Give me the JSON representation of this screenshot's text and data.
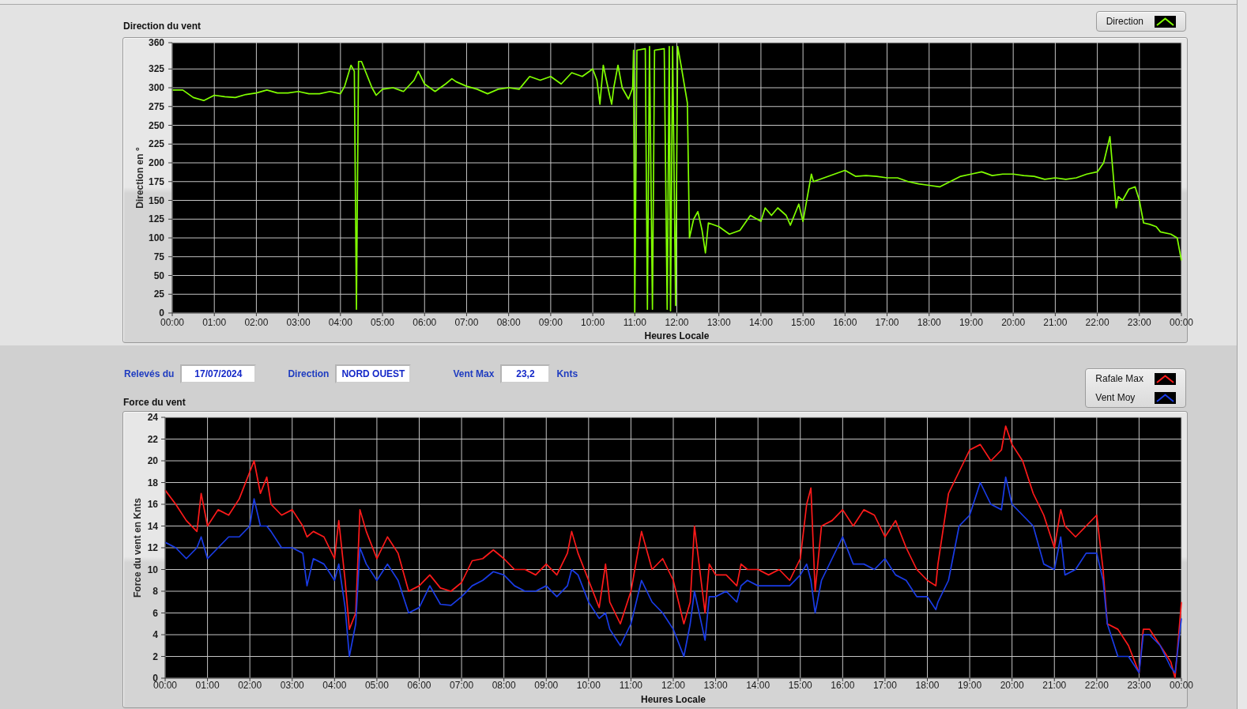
{
  "direction_chart": {
    "chart_data": {
      "type": "line",
      "title": "Direction du vent",
      "xlabel": "Heures Locale",
      "ylabel": "Direction en °",
      "grid": true,
      "legend": true,
      "x": [
        0,
        0.25,
        0.5,
        0.75,
        1,
        1.25,
        1.5,
        1.75,
        2,
        2.25,
        2.5,
        2.75,
        3,
        3.25,
        3.5,
        3.75,
        4,
        4.1,
        4.25,
        4.33,
        4.38,
        4.43,
        4.5,
        4.75,
        4.85,
        5,
        5.25,
        5.5,
        5.75,
        5.85,
        6,
        6.25,
        6.5,
        6.65,
        6.75,
        7,
        7.25,
        7.5,
        7.75,
        8,
        8.25,
        8.5,
        8.75,
        9,
        9.25,
        9.5,
        9.75,
        10,
        10.1,
        10.17,
        10.25,
        10.4,
        10.45,
        10.5,
        10.6,
        10.7,
        10.85,
        10.95,
        10.97,
        11,
        11.05,
        11.25,
        11.3,
        11.35,
        11.42,
        11.47,
        11.7,
        11.77,
        11.82,
        11.85,
        11.9,
        11.97,
        12.02,
        12.1,
        12.25,
        12.3,
        12.4,
        12.5,
        12.6,
        12.68,
        12.75,
        13,
        13.25,
        13.5,
        13.75,
        14,
        14.1,
        14.25,
        14.4,
        14.6,
        14.7,
        14.9,
        15,
        15.2,
        15.25,
        15.5,
        15.75,
        16,
        16.25,
        16.5,
        16.75,
        17,
        17.25,
        17.5,
        17.75,
        18,
        18.25,
        18.5,
        18.75,
        19,
        19.25,
        19.5,
        19.75,
        20,
        20.25,
        20.5,
        20.75,
        21,
        21.25,
        21.5,
        21.75,
        22,
        22.15,
        22.3,
        22.4,
        22.45,
        22.5,
        22.6,
        22.75,
        22.9,
        23,
        23.1,
        23.25,
        23.4,
        23.5,
        23.75,
        23.9,
        24
      ],
      "series": [
        {
          "name": "Direction",
          "color": "#80ff00",
          "values": [
            297,
            297,
            287,
            283,
            290,
            288,
            287,
            291,
            293,
            297,
            293,
            293,
            295,
            292,
            292,
            295,
            292,
            302,
            330,
            322,
            5,
            335,
            335,
            300,
            290,
            298,
            300,
            295,
            310,
            322,
            305,
            295,
            305,
            312,
            308,
            302,
            298,
            292,
            298,
            300,
            298,
            315,
            310,
            315,
            305,
            320,
            315,
            325,
            310,
            278,
            330,
            290,
            278,
            300,
            330,
            300,
            285,
            300,
            350,
            0,
            350,
            352,
            5,
            355,
            5,
            350,
            352,
            5,
            355,
            3,
            355,
            10,
            355,
            330,
            280,
            100,
            125,
            135,
            110,
            80,
            120,
            115,
            105,
            110,
            130,
            122,
            140,
            130,
            140,
            130,
            117,
            145,
            122,
            185,
            175,
            180,
            185,
            190,
            182,
            183,
            182,
            180,
            180,
            175,
            172,
            170,
            168,
            175,
            182,
            185,
            188,
            183,
            185,
            185,
            183,
            182,
            178,
            180,
            178,
            180,
            185,
            188,
            200,
            235,
            170,
            140,
            155,
            150,
            165,
            168,
            150,
            120,
            118,
            115,
            108,
            105,
            100,
            70
          ]
        }
      ],
      "xlim": [
        0,
        24
      ],
      "ylim": [
        0,
        360
      ],
      "xticks": [
        {
          "value": 0,
          "label": "00:00"
        },
        {
          "value": 1,
          "label": "01:00"
        },
        {
          "value": 2,
          "label": "02:00"
        },
        {
          "value": 3,
          "label": "03:00"
        },
        {
          "value": 4,
          "label": "04:00"
        },
        {
          "value": 5,
          "label": "05:00"
        },
        {
          "value": 6,
          "label": "06:00"
        },
        {
          "value": 7,
          "label": "07:00"
        },
        {
          "value": 8,
          "label": "08:00"
        },
        {
          "value": 9,
          "label": "09:00"
        },
        {
          "value": 10,
          "label": "10:00"
        },
        {
          "value": 11,
          "label": "11:00"
        },
        {
          "value": 12,
          "label": "12:00"
        },
        {
          "value": 13,
          "label": "13:00"
        },
        {
          "value": 14,
          "label": "14:00"
        },
        {
          "value": 15,
          "label": "15:00"
        },
        {
          "value": 16,
          "label": "16:00"
        },
        {
          "value": 17,
          "label": "17:00"
        },
        {
          "value": 18,
          "label": "18:00"
        },
        {
          "value": 19,
          "label": "19:00"
        },
        {
          "value": 20,
          "label": "20:00"
        },
        {
          "value": 21,
          "label": "21:00"
        },
        {
          "value": 22,
          "label": "22:00"
        },
        {
          "value": 23,
          "label": "23:00"
        },
        {
          "value": 24,
          "label": "00:00"
        }
      ],
      "yticks": [
        0,
        25,
        50,
        75,
        100,
        125,
        150,
        175,
        200,
        225,
        250,
        275,
        300,
        325,
        360
      ]
    }
  },
  "readings": [
    {
      "label": "Relevés du",
      "value": "17/07/2024"
    },
    {
      "label": "Direction",
      "value": "NORD OUEST"
    },
    {
      "label": "Vent Max",
      "value": "23,2",
      "unit": "Knts"
    }
  ],
  "force_chart": {
    "chart_data": {
      "type": "line",
      "title": "Force du vent",
      "xlabel": "Heures Locale",
      "ylabel": "Force du vent en Knts",
      "grid": true,
      "legend": true,
      "x": [
        0,
        0.25,
        0.5,
        0.75,
        0.85,
        1,
        1.25,
        1.5,
        1.75,
        2,
        2.1,
        2.25,
        2.4,
        2.5,
        2.75,
        3,
        3.25,
        3.35,
        3.5,
        3.75,
        4,
        4.1,
        4.25,
        4.35,
        4.5,
        4.6,
        4.75,
        5,
        5.25,
        5.5,
        5.75,
        6,
        6.25,
        6.5,
        6.75,
        7,
        7.25,
        7.5,
        7.75,
        8,
        8.25,
        8.5,
        8.75,
        9,
        9.25,
        9.5,
        9.6,
        9.75,
        10,
        10.25,
        10.4,
        10.5,
        10.75,
        11,
        11.25,
        11.5,
        11.75,
        12,
        12.25,
        12.4,
        12.5,
        12.75,
        12.85,
        13,
        13.25,
        13.5,
        13.6,
        13.75,
        14,
        14.25,
        14.5,
        14.75,
        15,
        15.15,
        15.25,
        15.35,
        15.5,
        15.75,
        16,
        16.25,
        16.5,
        16.75,
        17,
        17.25,
        17.5,
        17.75,
        18,
        18.2,
        18.25,
        18.5,
        18.75,
        19,
        19.25,
        19.5,
        19.75,
        19.85,
        20,
        20.25,
        20.5,
        20.75,
        21,
        21.15,
        21.25,
        21.5,
        21.75,
        22,
        22.15,
        22.25,
        22.5,
        22.75,
        23,
        23.1,
        23.25,
        23.5,
        23.75,
        23.85,
        24
      ],
      "series": [
        {
          "name": "Rafale Max",
          "color": "#ff1a1a",
          "values": [
            17.3,
            16,
            14.5,
            13.5,
            17,
            14,
            15.5,
            15,
            16.5,
            19,
            20,
            17,
            18.5,
            16,
            15,
            15.5,
            14,
            13,
            13.5,
            13,
            11,
            14.5,
            9,
            4.5,
            6,
            15.5,
            13.5,
            11,
            13,
            11.5,
            8,
            8.5,
            9.5,
            8.3,
            8,
            8.8,
            10.8,
            11,
            11.8,
            11,
            10,
            10,
            9.5,
            10.5,
            9.5,
            11.5,
            13.5,
            11.5,
            9,
            6.5,
            10.5,
            7,
            5,
            8,
            13.5,
            10,
            11,
            9,
            5,
            7,
            14,
            6,
            10.5,
            9.5,
            9.5,
            8.5,
            10.5,
            10,
            10,
            9.5,
            10,
            9,
            11,
            16,
            17.5,
            8,
            14,
            14.5,
            15.5,
            14,
            15.5,
            15,
            13,
            14.5,
            12,
            10,
            9,
            8.5,
            10.5,
            17,
            19,
            21,
            21.5,
            20,
            21,
            23.2,
            21.5,
            20,
            17,
            15,
            12,
            15.5,
            14,
            13,
            14,
            15,
            10,
            5,
            4.5,
            3,
            0.5,
            4.5,
            4.5,
            3,
            1.5,
            0,
            7
          ]
        },
        {
          "name": "Vent Moy",
          "color": "#1a3ce6",
          "values": [
            12.5,
            12,
            11,
            12,
            13,
            11,
            12,
            13,
            13,
            14,
            16.5,
            14,
            14,
            13.5,
            12,
            12,
            11.5,
            8.5,
            11,
            10.5,
            9,
            10.5,
            6.5,
            2,
            5,
            12,
            10.5,
            9,
            10.5,
            9,
            6,
            6.5,
            8.5,
            6.8,
            6.7,
            7.5,
            8.5,
            9,
            9.8,
            9.5,
            8.5,
            8,
            8,
            8.5,
            7.5,
            8.5,
            10,
            9.5,
            7,
            5.5,
            6,
            4.5,
            3,
            5,
            9,
            7,
            6,
            4.5,
            2,
            5,
            8,
            3.5,
            7.5,
            7.5,
            8,
            7,
            8.5,
            9,
            8.5,
            8.5,
            8.5,
            8.5,
            9.5,
            10.5,
            9,
            6,
            9,
            11,
            13,
            10.5,
            10.5,
            10,
            11,
            9.5,
            9,
            7.5,
            7.5,
            6.3,
            7,
            9,
            14,
            15,
            18,
            16,
            15.5,
            18.5,
            16,
            15,
            14,
            10.5,
            10,
            13,
            9.5,
            10,
            11.5,
            11.5,
            9,
            5,
            2,
            2,
            0.5,
            4,
            4,
            3,
            1,
            0.5,
            5.5
          ]
        }
      ],
      "xlim": [
        0,
        24
      ],
      "ylim": [
        0,
        24
      ],
      "xticks": [
        {
          "value": 0,
          "label": "00:00"
        },
        {
          "value": 1,
          "label": "01:00"
        },
        {
          "value": 2,
          "label": "02:00"
        },
        {
          "value": 3,
          "label": "03:00"
        },
        {
          "value": 4,
          "label": "04:00"
        },
        {
          "value": 5,
          "label": "05:00"
        },
        {
          "value": 6,
          "label": "06:00"
        },
        {
          "value": 7,
          "label": "07:00"
        },
        {
          "value": 8,
          "label": "08:00"
        },
        {
          "value": 9,
          "label": "09:00"
        },
        {
          "value": 10,
          "label": "10:00"
        },
        {
          "value": 11,
          "label": "11:00"
        },
        {
          "value": 12,
          "label": "12:00"
        },
        {
          "value": 13,
          "label": "13:00"
        },
        {
          "value": 14,
          "label": "14:00"
        },
        {
          "value": 15,
          "label": "15:00"
        },
        {
          "value": 16,
          "label": "16:00"
        },
        {
          "value": 17,
          "label": "17:00"
        },
        {
          "value": 18,
          "label": "18:00"
        },
        {
          "value": 19,
          "label": "19:00"
        },
        {
          "value": 20,
          "label": "20:00"
        },
        {
          "value": 21,
          "label": "21:00"
        },
        {
          "value": 22,
          "label": "22:00"
        },
        {
          "value": 23,
          "label": "23:00"
        },
        {
          "value": 24,
          "label": "00:00"
        }
      ],
      "yticks": [
        0,
        2,
        4,
        6,
        8,
        10,
        12,
        14,
        16,
        18,
        20,
        22,
        24
      ]
    }
  }
}
